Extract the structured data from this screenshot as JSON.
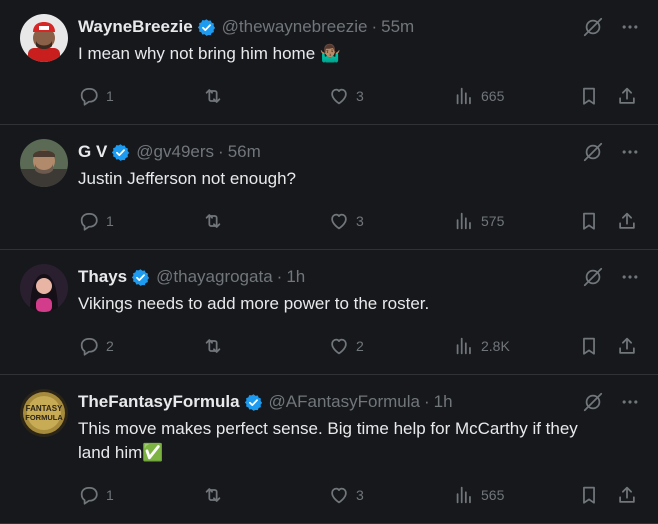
{
  "colors": {
    "background": "#16181c",
    "verified": "#1d9bf0",
    "text": "#e7e9ea",
    "muted": "#71767b",
    "divider": "#2f3336"
  },
  "tweets": [
    {
      "name": "WayneBreezie",
      "handle": "@thewaynebreezie",
      "sep": "·",
      "time": "55m",
      "text": "I mean why not bring him home 🤷🏽‍♂️",
      "replies": "1",
      "likes": "3",
      "views": "665",
      "avatar": "person-red-cap-avatar"
    },
    {
      "name": "G V",
      "handle": "@gv49ers",
      "sep": "·",
      "time": "56m",
      "text": "Justin Jefferson not enough?",
      "replies": "1",
      "likes": "3",
      "views": "575",
      "avatar": "person-outdoor-avatar"
    },
    {
      "name": "Thays",
      "handle": "@thayagrogata",
      "sep": "·",
      "time": "1h",
      "text": "Vikings needs to add more power to the roster.",
      "replies": "2",
      "likes": "2",
      "views": "2.8K",
      "avatar": "person-dark-hair-avatar"
    },
    {
      "name": "TheFantasyFormula",
      "handle": "@AFantasyFormula",
      "sep": "·",
      "time": "1h",
      "text": "This move makes perfect sense. Big time help for McCarthy if they land him✅",
      "replies": "1",
      "likes": "3",
      "views": "565",
      "avatar": "fantasy-formula-logo",
      "logo_text": "FANTASY FORMULA"
    }
  ]
}
